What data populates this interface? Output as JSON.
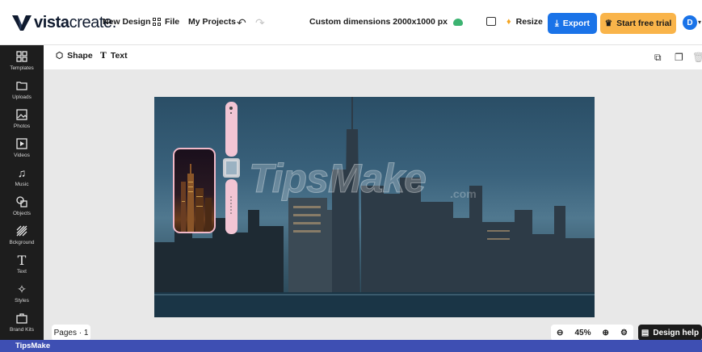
{
  "header": {
    "logo_bold": "vista",
    "logo_light": "create.",
    "new_design": "New Design",
    "file": "File",
    "my_projects": "My Projects",
    "doc_title": "Custom dimensions 2000x1000 px",
    "resize": "Resize",
    "export": "Export",
    "start_trial": "Start free trial",
    "avatar_initial": "D"
  },
  "sidebar": {
    "items": [
      {
        "label": "Templates",
        "icon": "templates-icon"
      },
      {
        "label": "Uploads",
        "icon": "uploads-icon"
      },
      {
        "label": "Photos",
        "icon": "photos-icon"
      },
      {
        "label": "Videos",
        "icon": "videos-icon"
      },
      {
        "label": "Music",
        "icon": "music-icon"
      },
      {
        "label": "Objects",
        "icon": "objects-icon"
      },
      {
        "label": "Bckground",
        "icon": "background-icon"
      },
      {
        "label": "Text",
        "icon": "text-icon"
      },
      {
        "label": "Styles",
        "icon": "styles-icon"
      },
      {
        "label": "Brand Kits",
        "icon": "brand-kits-icon"
      }
    ]
  },
  "toolbar": {
    "shape": "Shape",
    "text": "Text"
  },
  "canvas": {
    "watermark": "TipsMake",
    "watermark_suffix": ".com"
  },
  "bottom": {
    "pages": "Pages · 1",
    "zoom": "45%",
    "design_help": "Design help"
  },
  "footer": {
    "brand": "TipsMake"
  },
  "colors": {
    "accent": "#1a73e8",
    "trial": "#f9b44a",
    "sidebar": "#1d1d1d",
    "footer": "#3e4fb3"
  }
}
